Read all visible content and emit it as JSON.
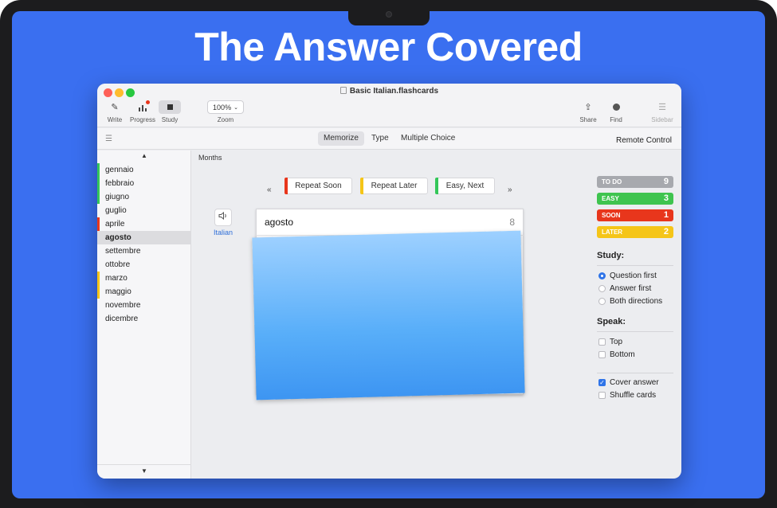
{
  "headline": {
    "before": "The Answer ",
    "highlight": "Covered"
  },
  "window": {
    "title": "Basic Italian.flashcards"
  },
  "toolbar": {
    "write": "Write",
    "progress": "Progress",
    "study": "Study",
    "zoom_value": "100%",
    "zoom_label": "Zoom",
    "share": "Share",
    "find": "Find",
    "sidebar": "Sidebar"
  },
  "modes": {
    "memorize": "Memorize",
    "type": "Type",
    "multiple_choice": "Multiple Choice",
    "remote_control": "Remote Control"
  },
  "sidebar": {
    "items": [
      {
        "label": "gennaio",
        "mark": "#34c759"
      },
      {
        "label": "febbraio",
        "mark": "#34c759"
      },
      {
        "label": "giugno",
        "mark": "#34c759"
      },
      {
        "label": "guglio",
        "mark": ""
      },
      {
        "label": "aprile",
        "mark": "#e8361c"
      },
      {
        "label": "agosto",
        "mark": ""
      },
      {
        "label": "settembre",
        "mark": ""
      },
      {
        "label": "ottobre",
        "mark": ""
      },
      {
        "label": "marzo",
        "mark": "#f5c518"
      },
      {
        "label": "maggio",
        "mark": "#f5c518"
      },
      {
        "label": "novembre",
        "mark": ""
      },
      {
        "label": "dicembre",
        "mark": ""
      }
    ],
    "selected_index": 5
  },
  "main": {
    "section_title": "Months",
    "prev": "«",
    "next": "»",
    "buttons": [
      {
        "label": "Repeat Soon",
        "color": "#e8361c"
      },
      {
        "label": "Repeat Later",
        "color": "#f5c518"
      },
      {
        "label": "Easy, Next",
        "color": "#34c759"
      }
    ],
    "speaker_language": "Italian",
    "card_word": "agosto",
    "card_number": "8"
  },
  "stats": [
    {
      "label": "TO DO",
      "value": "9",
      "color": "#a7a9ae"
    },
    {
      "label": "EASY",
      "value": "3",
      "color": "#3fc44f"
    },
    {
      "label": "SOON",
      "value": "1",
      "color": "#e8361c"
    },
    {
      "label": "LATER",
      "value": "2",
      "color": "#f5c518"
    }
  ],
  "study": {
    "heading": "Study:",
    "options": [
      "Question first",
      "Answer first",
      "Both directions"
    ],
    "selected": 0
  },
  "speak": {
    "heading": "Speak:",
    "options": [
      "Top",
      "Bottom"
    ]
  },
  "extras": {
    "cover_answer": "Cover answer",
    "shuffle_cards": "Shuffle cards",
    "cover_checked": true
  },
  "colors": {
    "accent": "#2f74e8",
    "background": "#3a6ff0"
  }
}
